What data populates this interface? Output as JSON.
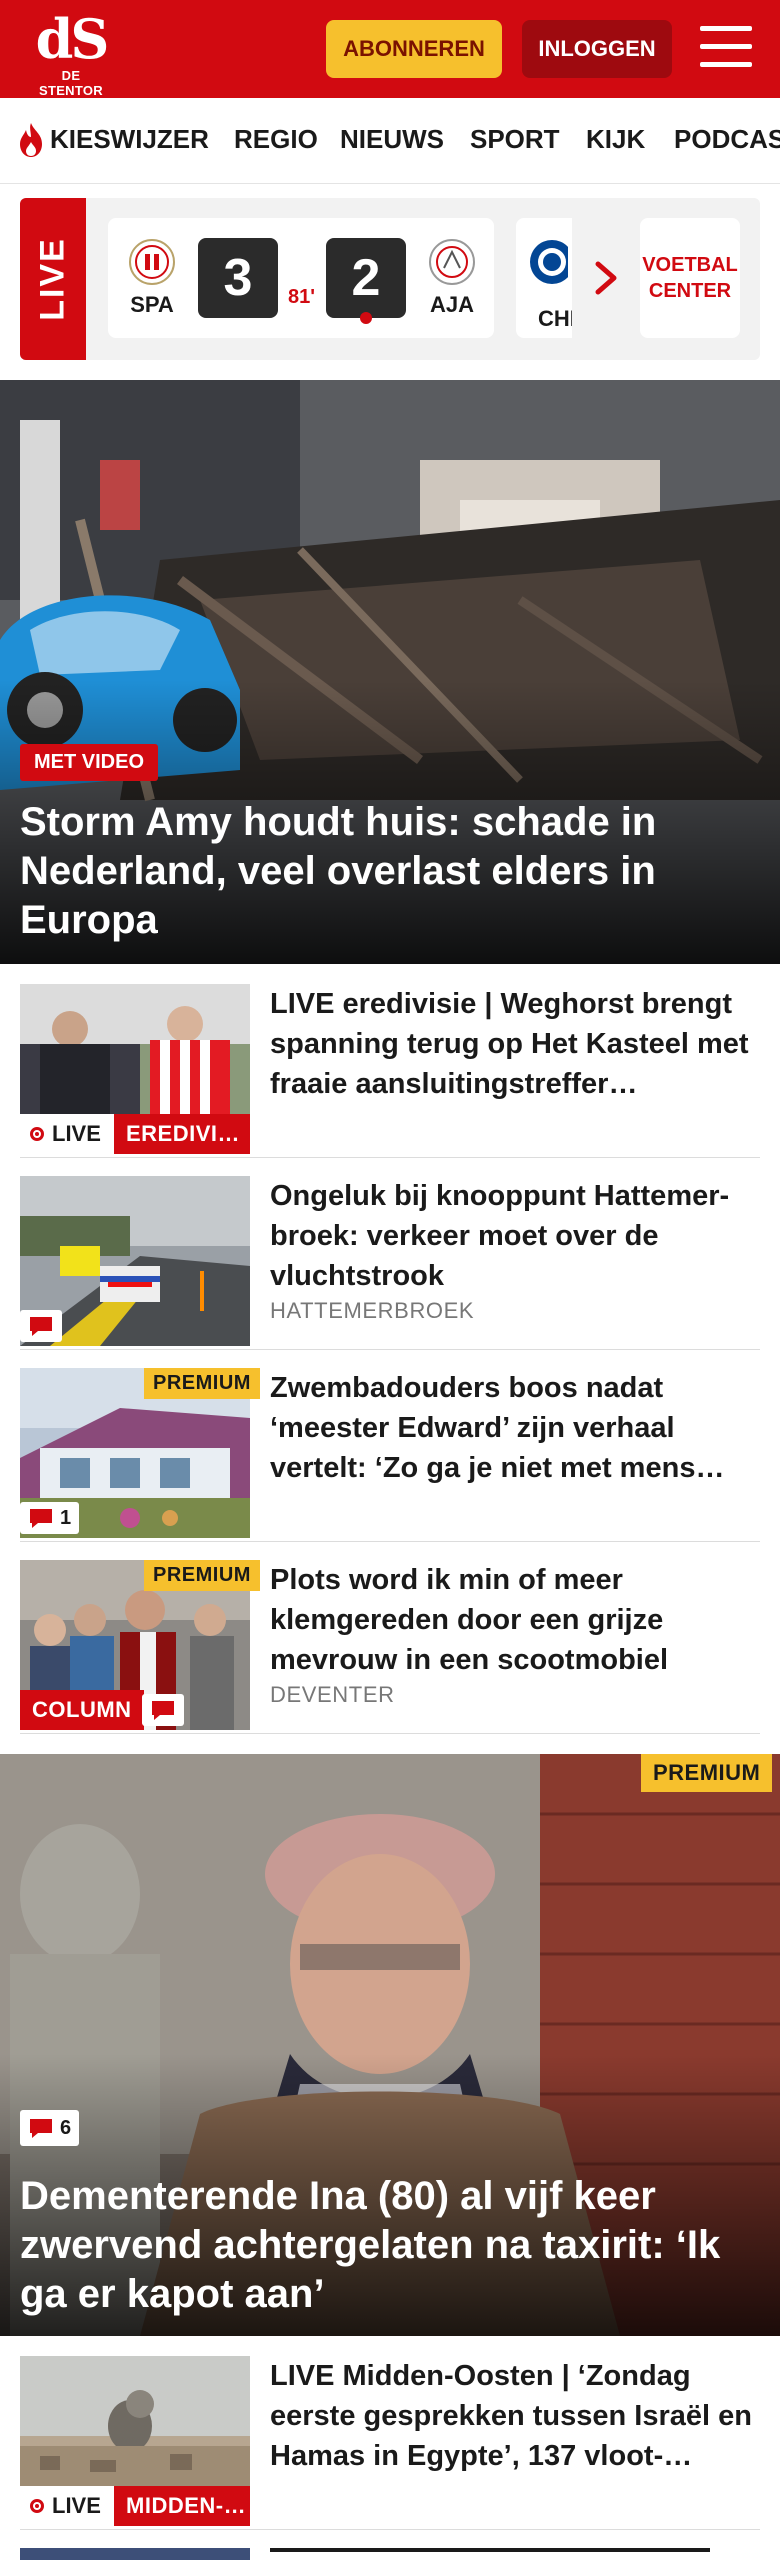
{
  "header": {
    "logo_mark": "dS",
    "logo_name": "DE STENTOR",
    "subscribe_label": "ABONNEREN",
    "login_label": "INLOGGEN",
    "brand_color": "#d10a11",
    "accent_color": "#f6c02d"
  },
  "nav": {
    "items": [
      "KIESWIJZER",
      "REGIO",
      "NIEUWS",
      "SPORT",
      "KIJK",
      "PODCAS"
    ]
  },
  "livebar": {
    "live_label": "LIVE",
    "match": {
      "home_name": "SPA",
      "home_score": "3",
      "minute": "81'",
      "away_score": "2",
      "away_name": "AJA"
    },
    "next_club_name": "CHI",
    "voetbal_line1": "VOETBAL",
    "voetbal_line2": "CENTER"
  },
  "hero": {
    "badge": "MET VIDEO",
    "title": "Storm Amy houdt huis: schade in Nederland, veel overlast elders in Europa"
  },
  "articles": [
    {
      "title": "LIVE eredivisie | Weghorst brengt spanning terug op Het Kasteel met fraaie aansluitingstreffer…",
      "live_label": "LIVE",
      "category": "EREDIVI…"
    },
    {
      "title": "Ongeluk bij knooppunt Hattemer­broek: verkeer moet over de vluchtstrook",
      "meta": "HATTEMERBROEK"
    },
    {
      "title": "Zwembadouders boos nadat ‘meester Edward’ zijn verhaal vertelt: ‘Zo ga je niet met mens…",
      "premium": "PREMIUM",
      "comments": "1"
    },
    {
      "title": "Plots word ik min of meer klemgereden door een grijze mevrouw in een scootmobiel",
      "meta": "DEVENTER",
      "premium": "PREMIUM",
      "category": "COLUMN"
    }
  ],
  "feature": {
    "premium": "PREMIUM",
    "comments": "6",
    "title": "Dementerende Ina (80) al vijf keer zwervend achtergelaten na taxirit: ‘Ik ga er kapot aan’"
  },
  "article_bottom": {
    "title": "LIVE Midden-Oosten | ‘Zondag eerste gesprekken tussen Israël en Hamas in Egypte’, 137 vloot-…",
    "live_label": "LIVE",
    "category": "MIDDEN-…"
  }
}
